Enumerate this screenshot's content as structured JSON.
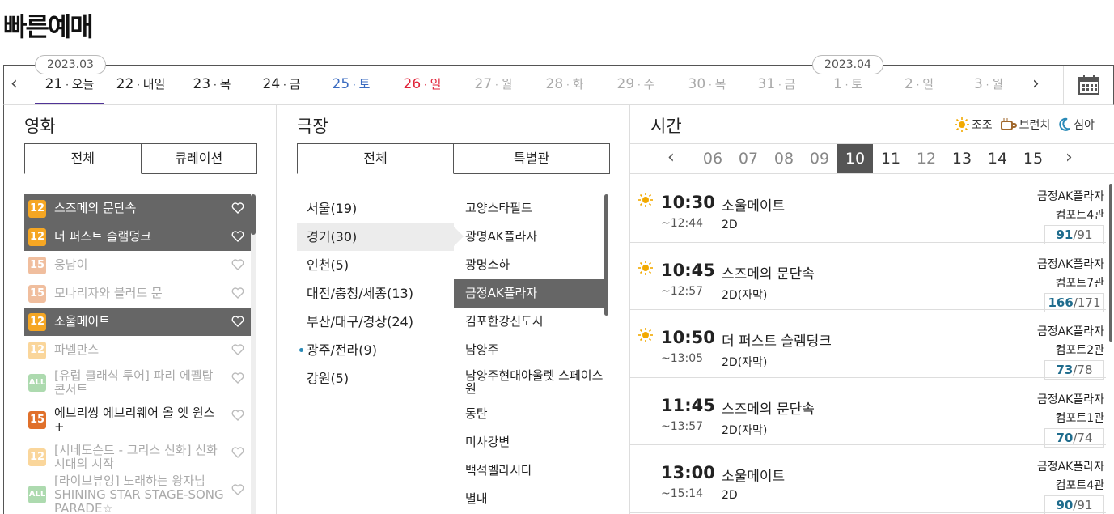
{
  "page_title": "빠른예매",
  "months": [
    "2023.03",
    "2023.04"
  ],
  "dates": [
    {
      "day": "21",
      "dow": "오늘",
      "type": "active"
    },
    {
      "day": "22",
      "dow": "내일",
      "type": "normal"
    },
    {
      "day": "23",
      "dow": "목",
      "type": "normal"
    },
    {
      "day": "24",
      "dow": "금",
      "type": "normal"
    },
    {
      "day": "25",
      "dow": "토",
      "type": "sat"
    },
    {
      "day": "26",
      "dow": "일",
      "type": "sun"
    },
    {
      "day": "27",
      "dow": "월",
      "type": "dim"
    },
    {
      "day": "28",
      "dow": "화",
      "type": "dim"
    },
    {
      "day": "29",
      "dow": "수",
      "type": "dim"
    },
    {
      "day": "30",
      "dow": "목",
      "type": "dim"
    },
    {
      "day": "31",
      "dow": "금",
      "type": "dim"
    },
    {
      "day": "1",
      "dow": "토",
      "type": "dim"
    },
    {
      "day": "2",
      "dow": "일",
      "type": "dim"
    },
    {
      "day": "3",
      "dow": "월",
      "type": "dim"
    }
  ],
  "movie": {
    "title": "영화",
    "tabs": [
      "전체",
      "큐레이션"
    ],
    "items": [
      {
        "rating": "12",
        "title": "스즈메의 문단속",
        "state": "sel"
      },
      {
        "rating": "12",
        "title": "더 퍼스트 슬램덩크",
        "state": "sel"
      },
      {
        "rating": "15",
        "title": "웅남이",
        "state": "dim"
      },
      {
        "rating": "15",
        "title": "모나리자와 블러드 문",
        "state": "dim"
      },
      {
        "rating": "12",
        "title": "소울메이트",
        "state": "sel"
      },
      {
        "rating": "12",
        "title": "파벨만스",
        "state": "dim"
      },
      {
        "rating": "ALL",
        "title": "[유럽 클래식 투어] 파리 에펠탑 콘서트",
        "state": "dim"
      },
      {
        "rating": "15",
        "title": "에브리씽 에브리웨어 올 앳 원스 +",
        "state": "normal"
      },
      {
        "rating": "12",
        "title": "[시네도슨트 - 그리스 신화] 신화시대의 시작",
        "state": "dim"
      },
      {
        "rating": "ALL",
        "title": "[라이브뷰잉] 노래하는 왕자님 SHINING STAR STAGE-SONG PARADE☆",
        "state": "dim"
      }
    ]
  },
  "theater": {
    "title": "극장",
    "tabs": [
      "전체",
      "특별관"
    ],
    "regions": [
      "서울(19)",
      "경기(30)",
      "인천(5)",
      "대전/충청/세종(13)",
      "부산/대구/경상(24)",
      "광주/전라(9)",
      "강원(5)"
    ],
    "branches": [
      "고양스타필드",
      "광명AK플라자",
      "광명소하",
      "금정AK플라자",
      "김포한강신도시",
      "남양주",
      "남양주현대아울렛 스페이스원",
      "동탄",
      "미사강변",
      "백석벨라시타",
      "별내"
    ]
  },
  "time": {
    "title": "시간",
    "legend": [
      "조조",
      "브런치",
      "심야"
    ],
    "hours": [
      "06",
      "07",
      "08",
      "09",
      "10",
      "11",
      "12",
      "13",
      "14",
      "15"
    ],
    "showings": [
      {
        "start": "10:30",
        "end": "~12:44",
        "movie": "소울메이트",
        "format": "2D",
        "theater": "금정AK플라자",
        "hall": "컴포트4관",
        "avail": "91",
        "total": "/91",
        "morning": true
      },
      {
        "start": "10:45",
        "end": "~12:57",
        "movie": "스즈메의 문단속",
        "format": "2D(자막)",
        "theater": "금정AK플라자",
        "hall": "컴포트7관",
        "avail": "166",
        "total": "/171",
        "morning": true
      },
      {
        "start": "10:50",
        "end": "~13:05",
        "movie": "더 퍼스트 슬램덩크",
        "format": "2D(자막)",
        "theater": "금정AK플라자",
        "hall": "컴포트2관",
        "avail": "73",
        "total": "/78",
        "morning": true
      },
      {
        "start": "11:45",
        "end": "~13:57",
        "movie": "스즈메의 문단속",
        "format": "2D(자막)",
        "theater": "금정AK플라자",
        "hall": "컴포트1관",
        "avail": "70",
        "total": "/74",
        "morning": false
      },
      {
        "start": "13:00",
        "end": "~15:14",
        "movie": "소울메이트",
        "format": "2D",
        "theater": "금정AK플라자",
        "hall": "컴포트4관",
        "avail": "90",
        "total": "/91",
        "morning": false
      }
    ]
  }
}
